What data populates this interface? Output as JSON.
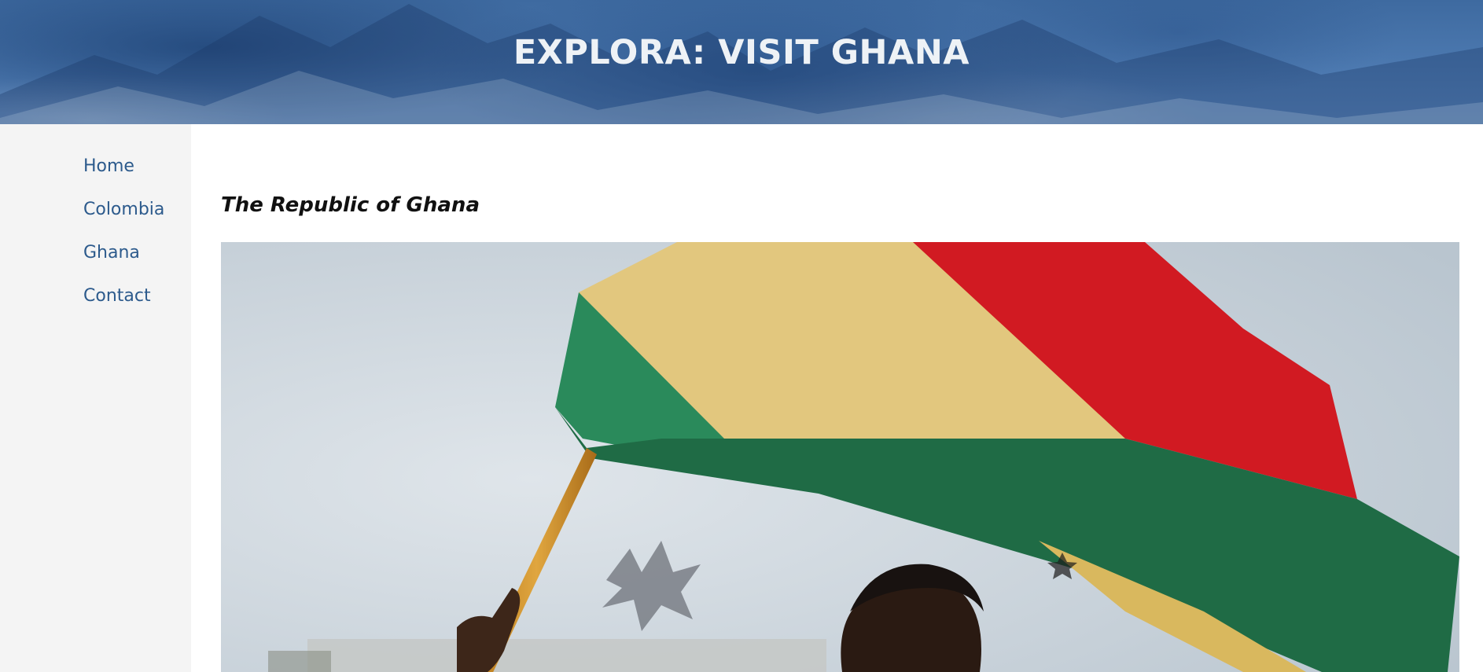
{
  "header": {
    "title": "EXPLORA: VISIT GHANA"
  },
  "sidebar": {
    "items": [
      {
        "label": "Home"
      },
      {
        "label": "Colombia"
      },
      {
        "label": "Ghana"
      },
      {
        "label": "Contact"
      }
    ]
  },
  "main": {
    "heading": "The Republic of Ghana"
  },
  "colors": {
    "header_bg": "#4e7bb2",
    "nav_link": "#2c5a8c",
    "sidebar_bg": "#f4f4f4",
    "flag_red": "#d0232a",
    "flag_gold": "#e6c878",
    "flag_green": "#1f6b45"
  }
}
